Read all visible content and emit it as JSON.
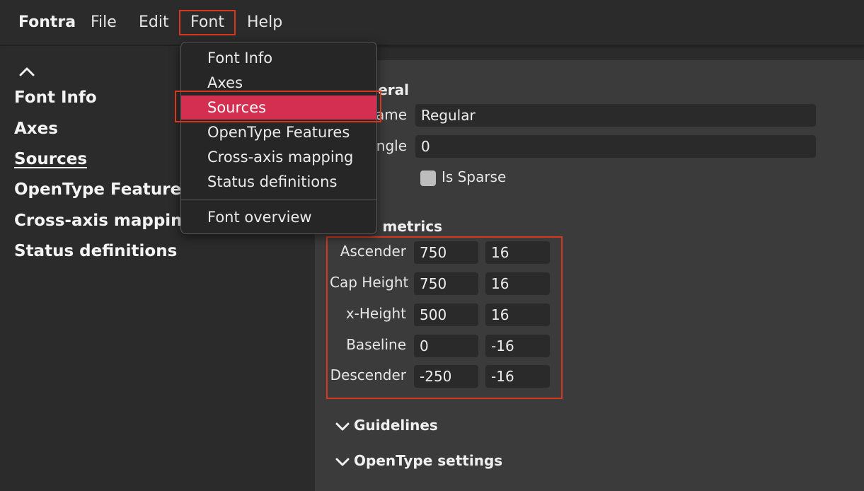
{
  "menubar": {
    "brand": "Fontra",
    "file": "File",
    "edit": "Edit",
    "font": "Font",
    "help": "Help"
  },
  "sidebar": {
    "items": [
      {
        "label": "Font Info"
      },
      {
        "label": "Axes"
      },
      {
        "label": "Sources",
        "active": true
      },
      {
        "label": "OpenType Features"
      },
      {
        "label": "Cross-axis mapping"
      },
      {
        "label": "Status definitions"
      }
    ]
  },
  "font_menu": {
    "items": [
      {
        "label": "Font Info"
      },
      {
        "label": "Axes"
      },
      {
        "label": "Sources",
        "selected": true
      },
      {
        "label": "OpenType Features"
      },
      {
        "label": "Cross-axis mapping"
      },
      {
        "label": "Status definitions"
      }
    ],
    "overview": "Font overview"
  },
  "general": {
    "title_visible": "neral",
    "name_label_visible": "ame",
    "name_value": "Regular",
    "angle_label_visible": "ngle",
    "angle_value": "0",
    "is_sparse_label": "Is Sparse",
    "is_sparse_checked": false
  },
  "metrics": {
    "title_visible": "e metrics",
    "rows": [
      {
        "label": "Ascender",
        "value": "750",
        "overshoot": "16"
      },
      {
        "label": "Cap Height",
        "value": "750",
        "overshoot": "16"
      },
      {
        "label": "x-Height",
        "value": "500",
        "overshoot": "16"
      },
      {
        "label": "Baseline",
        "value": "0",
        "overshoot": "-16"
      },
      {
        "label": "Descender",
        "value": "-250",
        "overshoot": "-16"
      }
    ]
  },
  "collapsed_sections": {
    "guidelines": "Guidelines",
    "opentype_settings": "OpenType settings"
  },
  "colors": {
    "background": "#2b2b2b",
    "panel": "#3b3b3b",
    "input": "#2a2a2a",
    "menu_selected": "#d42f50",
    "annotation_red": "#d8371f"
  }
}
